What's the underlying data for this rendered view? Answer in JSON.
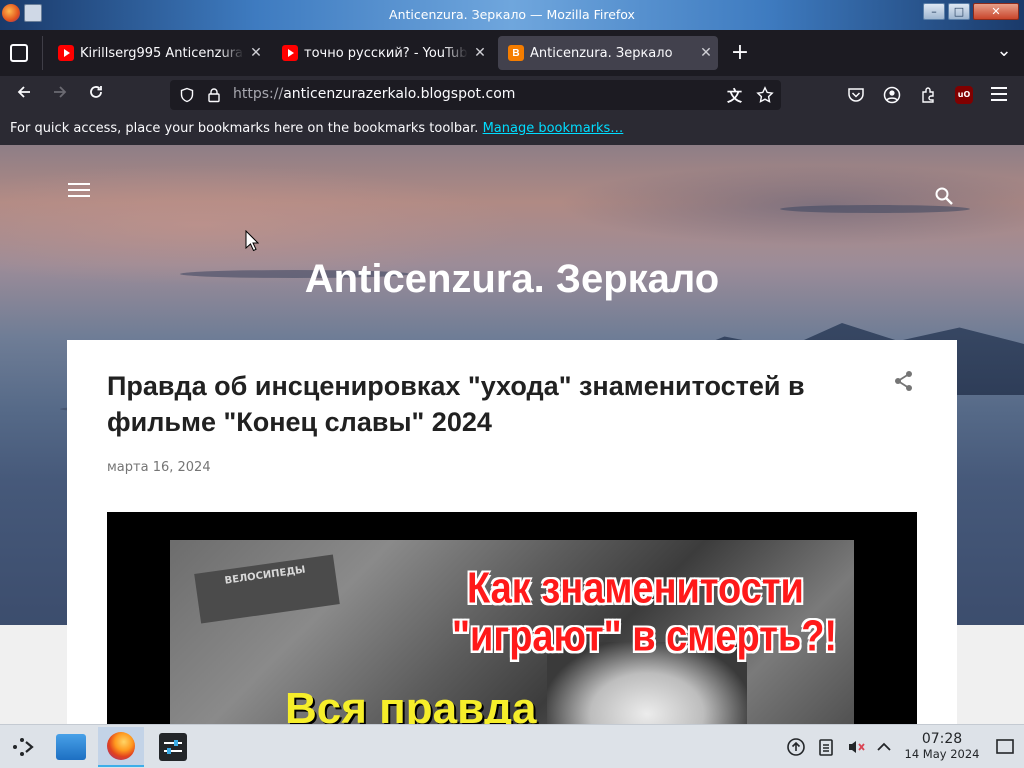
{
  "window": {
    "title": "Anticenzura. Зеркало — Mozilla Firefox",
    "buttons": {
      "minimize": "–",
      "maximize": "□",
      "close": "✕"
    }
  },
  "tabs": [
    {
      "label": "Kirillserg995 Anticenzura",
      "favicon": "youtube-icon",
      "active": false
    },
    {
      "label": "точно русский? - YouTube",
      "favicon": "youtube-icon",
      "active": false
    },
    {
      "label": "Anticenzura. Зеркало",
      "favicon": "blogger-icon",
      "active": true
    }
  ],
  "tab_controls": {
    "new_tab": "+",
    "list_all": "⌄",
    "close": "✕"
  },
  "nav": {
    "url_scheme": "https://",
    "url_host": "anticenzurazerkalo.blogspot.com"
  },
  "bookmarks_bar": {
    "message": "For quick access, place your bookmarks here on the bookmarks toolbar.",
    "link": "Manage bookmarks…"
  },
  "blog": {
    "title": "Anticenzura. Зеркало",
    "post": {
      "title": "Правда об инсценировках \"ухода\" знаменитостей в фильме \"Конец славы\" 2024",
      "date": "марта 16, 2024",
      "image": {
        "sign_text": "ВЕЛОСИПЕДЫ",
        "headline_line1": "Как знаменитости",
        "headline_line2": "\"играют\" в смерть?!",
        "yellow_text": "Вся правда"
      }
    }
  },
  "taskbar": {
    "time": "07:28",
    "date": "14 May 2024"
  },
  "colors": {
    "browser_bg": "#1c1b22",
    "toolbar_bg": "#2b2a33",
    "link": "#00ddff",
    "headline_red": "#ff1a1a",
    "headline_yellow": "#f6ee2a",
    "taskbar_bg": "#dde2e8"
  }
}
